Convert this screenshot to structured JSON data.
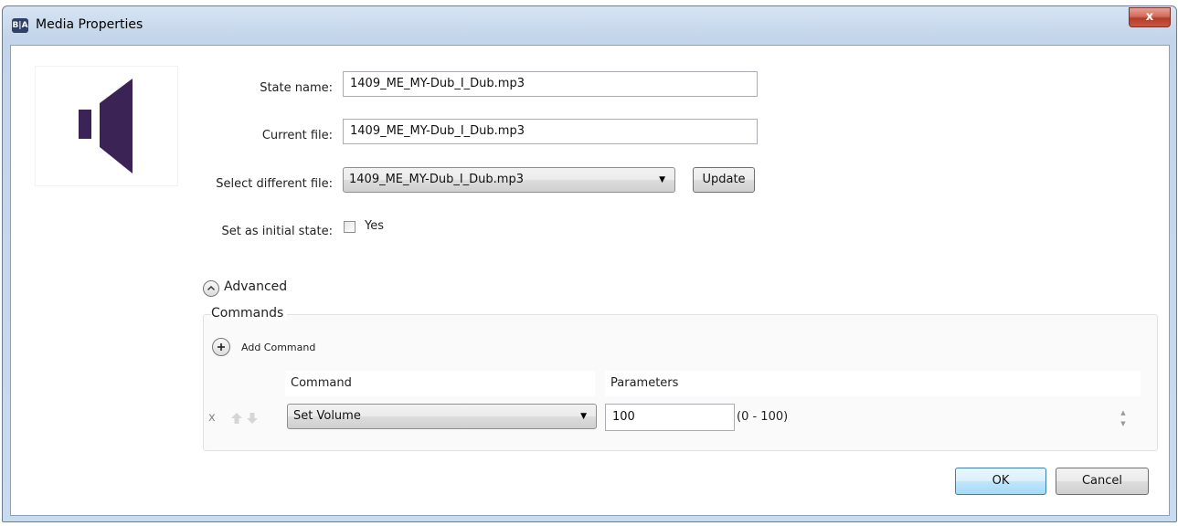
{
  "window": {
    "title": "Media Properties",
    "app_icon_text": "B|A",
    "close_glyph": "x"
  },
  "form": {
    "state_name_label": "State name:",
    "state_name_value": "1409_ME_MY-Dub_I_Dub.mp3",
    "current_file_label": "Current file:",
    "current_file_value": "1409_ME_MY-Dub_I_Dub.mp3",
    "select_file_label": "Select different file:",
    "select_file_value": "1409_ME_MY-Dub_I_Dub.mp3",
    "update_label": "Update",
    "initial_state_label": "Set as initial state:",
    "initial_state_option": "Yes",
    "initial_state_checked": false
  },
  "advanced": {
    "toggle_label": "Advanced",
    "commands_group_label": "Commands",
    "add_command_label": "Add Command",
    "columns": [
      "Command",
      "Parameters"
    ],
    "rows": [
      {
        "remove_glyph": "x",
        "command": "Set Volume",
        "parameter_value": "100",
        "parameter_range": "(0 - 100)"
      }
    ]
  },
  "footer": {
    "ok_label": "OK",
    "cancel_label": "Cancel"
  },
  "colors": {
    "media_icon": "#3b2455",
    "default_button_border": "#3c7fb1",
    "close_button": "#c95642"
  },
  "icons": {
    "media": "speaker-icon",
    "advanced_toggle": "chevron-up-circle-icon",
    "add_command": "plus-circle-icon",
    "move_up": "arrow-up-icon",
    "move_down": "arrow-down-icon",
    "combo_dropdown": "triangle-down-icon"
  }
}
